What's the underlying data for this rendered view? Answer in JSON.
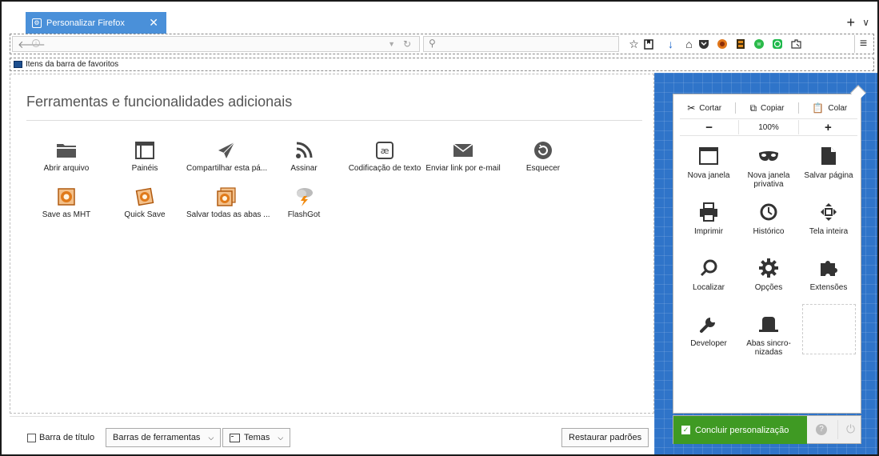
{
  "window": {
    "tab_title": "Personalizar Firefox",
    "tab_close": "✕",
    "new_tab": "+",
    "tab_menu": "⌵"
  },
  "navbar": {
    "url_value": "",
    "search_value": ""
  },
  "bookmarks": {
    "label": "Itens da barra de favoritos"
  },
  "palette": {
    "title": "Ferramentas e funcionalidades adicionais",
    "items": [
      {
        "label": "Abrir arquivo",
        "icon": "folder-icon"
      },
      {
        "label": "Painéis",
        "icon": "sidebar-icon"
      },
      {
        "label": "Compartilhar esta pá...",
        "icon": "share-icon"
      },
      {
        "label": "Assinar",
        "icon": "rss-icon"
      },
      {
        "label": "Codificação de texto",
        "icon": "encoding-icon"
      },
      {
        "label": "Enviar link por e-mail",
        "icon": "email-icon"
      },
      {
        "label": "Esquecer",
        "icon": "forget-icon"
      },
      {
        "label": "Save as MHT",
        "icon": "mht-icon"
      },
      {
        "label": "Quick Save",
        "icon": "quick-save-icon"
      },
      {
        "label": "Salvar todas as abas ...",
        "icon": "save-all-tabs-icon"
      },
      {
        "label": "FlashGot",
        "icon": "flashgot-icon"
      }
    ]
  },
  "bottombar": {
    "title_bar_label": "Barra de título",
    "toolbars_label": "Barras de ferramentas",
    "themes_label": "Temas",
    "restore_label": "Restaurar padrões"
  },
  "menu_panel": {
    "cut": "Cortar",
    "copy": "Copiar",
    "paste": "Colar",
    "zoom_out": "−",
    "zoom_level": "100%",
    "zoom_in": "+",
    "items": [
      {
        "label": "Nova janela",
        "icon": "new-window-icon"
      },
      {
        "label": "Nova janela privativa",
        "icon": "private-window-icon"
      },
      {
        "label": "Salvar página",
        "icon": "save-page-icon"
      },
      {
        "label": "Imprimir",
        "icon": "print-icon"
      },
      {
        "label": "Histórico",
        "icon": "history-icon"
      },
      {
        "label": "Tela inteira",
        "icon": "fullscreen-icon"
      },
      {
        "label": "Localizar",
        "icon": "find-icon"
      },
      {
        "label": "Opções",
        "icon": "options-icon"
      },
      {
        "label": "Extensões",
        "icon": "addons-icon"
      },
      {
        "label": "Developer",
        "icon": "developer-icon"
      },
      {
        "label": "Abas sincro-nizadas",
        "icon": "synced-tabs-icon"
      }
    ],
    "done_label": "Concluir personalização",
    "help": "?"
  },
  "colors": {
    "tab_blue": "#4a90d9",
    "panel_blue": "#2f74c9",
    "done_green": "#3f9a23"
  }
}
